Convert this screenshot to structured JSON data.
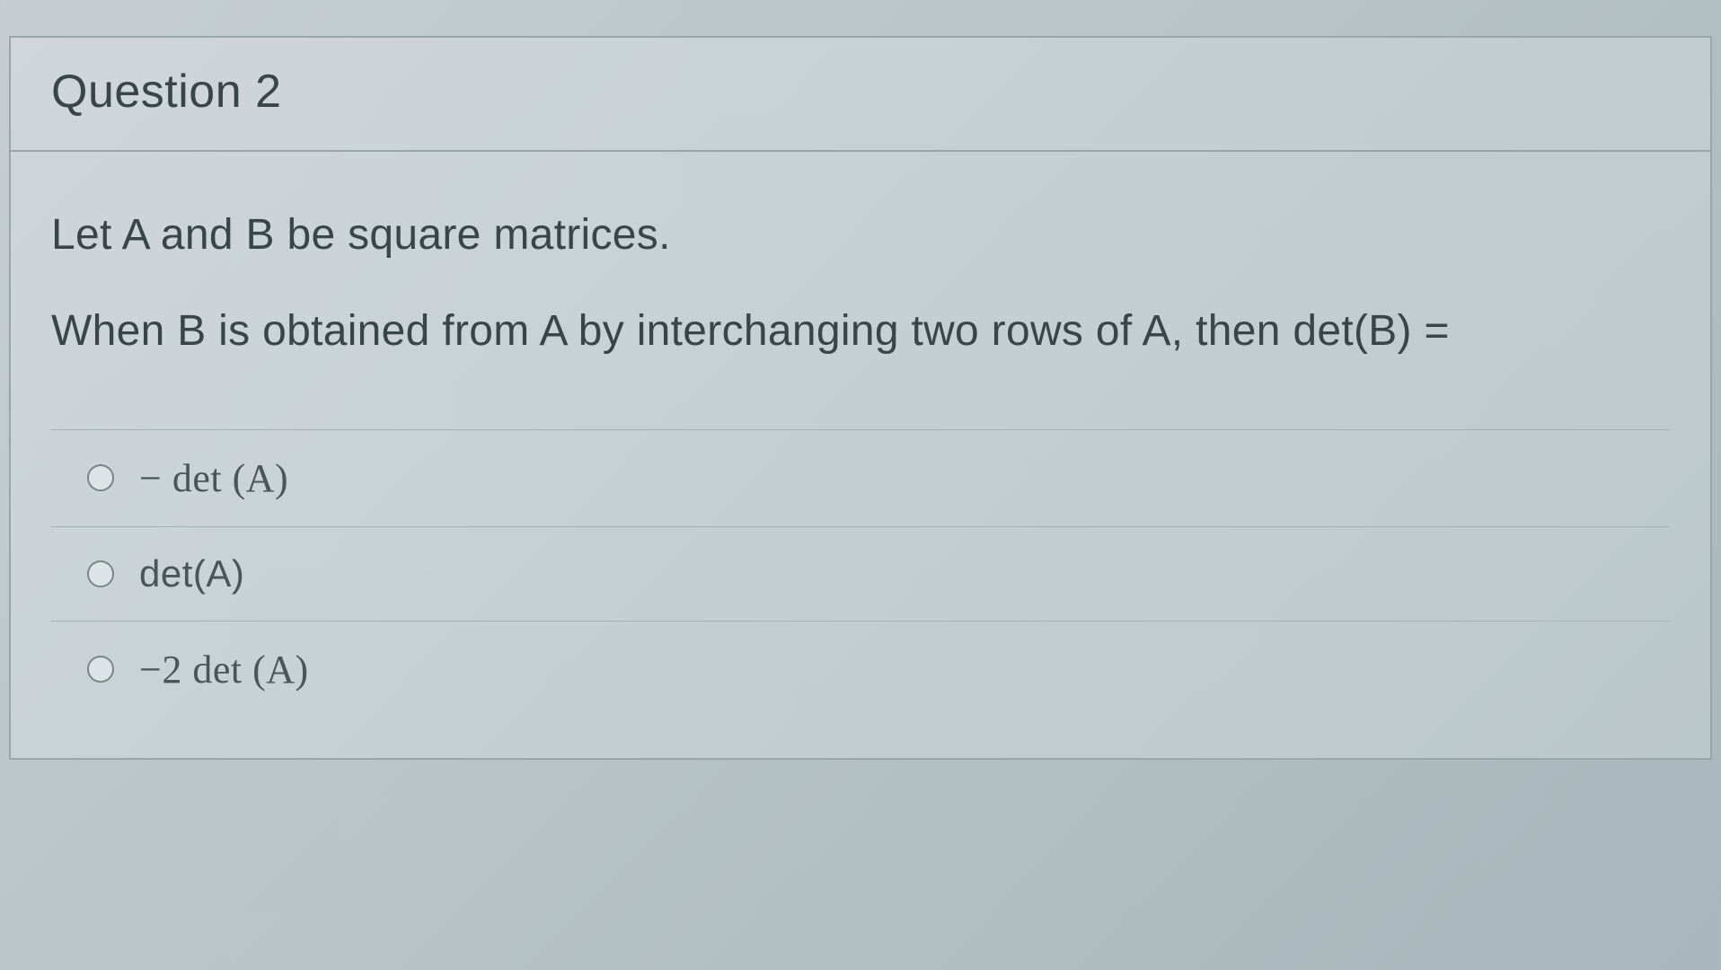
{
  "question": {
    "title": "Question 2",
    "prompt_line1": "Let A and B be square matrices.",
    "prompt_line2": "When B is obtained from A by interchanging two rows of A, then det(B) ="
  },
  "options": [
    {
      "label": "− det (A)"
    },
    {
      "label": "det(A)"
    },
    {
      "label": "−2 det (A)"
    }
  ]
}
